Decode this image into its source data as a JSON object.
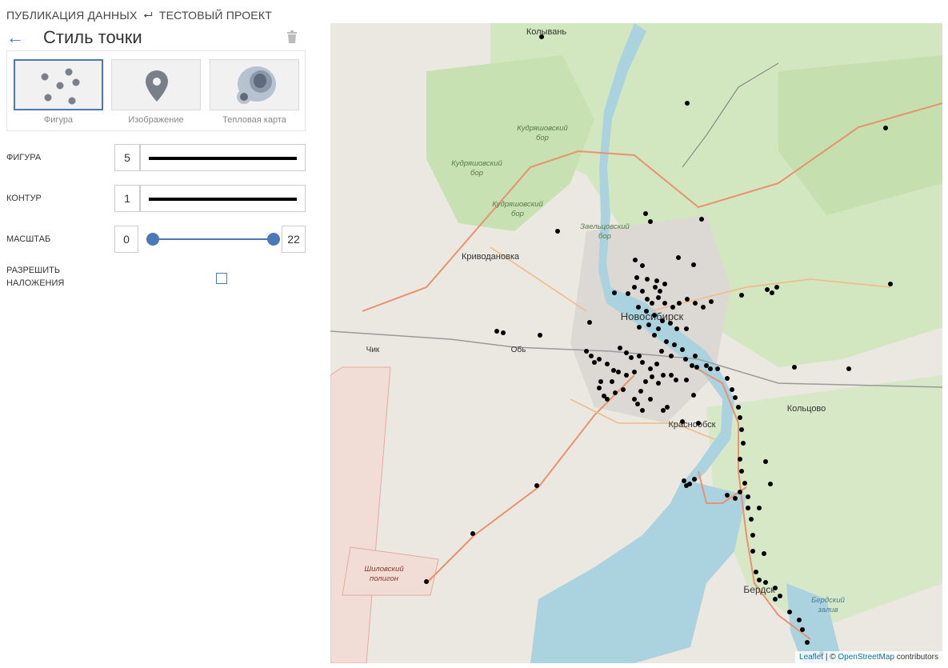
{
  "breadcrumb": {
    "item1": "ПУБЛИКАЦИЯ ДАННЫХ",
    "separator": "⮠",
    "item2": "ТЕСТОВЫЙ ПРОЕКТ"
  },
  "header": {
    "title": "Стиль точки",
    "back_icon": "←"
  },
  "style_types": [
    {
      "label": "Фигура",
      "icon": "scatter-points-icon",
      "selected": true
    },
    {
      "label": "Изображение",
      "icon": "map-pin-icon",
      "selected": false
    },
    {
      "label": "Тепловая карта",
      "icon": "heatmap-icon",
      "selected": false
    }
  ],
  "settings": {
    "shape": {
      "label": "ФИГУРА",
      "value": "5"
    },
    "outline": {
      "label": "КОНТУР",
      "value": "1"
    },
    "scale": {
      "label": "МАСШТАБ",
      "min": "0",
      "max": "22"
    },
    "overlap": {
      "label_line1": "РАЗРЕШИТЬ",
      "label_line2": "НАЛОЖЕНИЯ",
      "checked": false
    }
  },
  "map": {
    "labels": {
      "kolyvan": "Колывань",
      "kudr1a": "Кудряшовский",
      "kudr1b": "бор",
      "kudr2a": "Кудряшовский",
      "kudr2b": "бор",
      "kudr3a": "Кудряшовский",
      "kudr3b": "бор",
      "zaelt_a": "Заельцовский",
      "zaelt_b": "бор",
      "krivod": "Криводановка",
      "nsk": "Новосибирск",
      "ob": "Обь",
      "chik": "Чик",
      "koltsovo": "Кольцово",
      "krasnoobsk": "Краснообск",
      "shilov_a": "Шиловский",
      "shilov_b": "полигон",
      "berdsk": "Бердск",
      "berd_bay_a": "Бердский",
      "berd_bay_b": "залив"
    },
    "attribution": {
      "leaflet": "Leaflet",
      "separator": "| ©",
      "osm": "OpenStreetMap",
      "suffix": "contributors"
    }
  },
  "colors": {
    "accent": "#4a78b8",
    "water": "#aad3df",
    "forest": "#cfe5b9",
    "road": "#e8926f",
    "point": "#000000"
  }
}
